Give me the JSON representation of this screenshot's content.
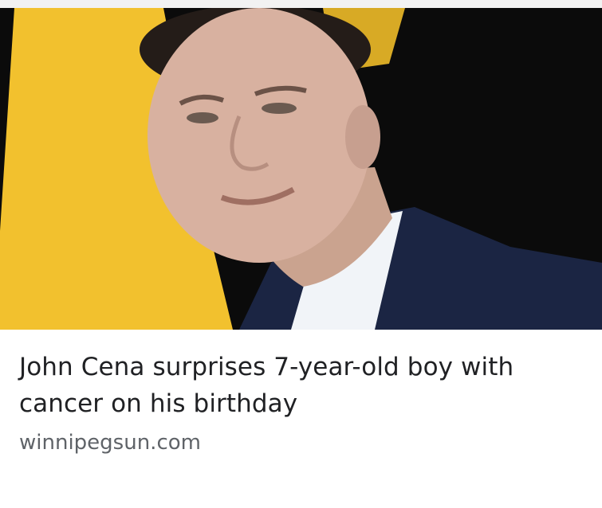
{
  "article": {
    "headline": "John Cena surprises 7-year-old boy with cancer on his birthday",
    "source": "winnipegsun.com"
  },
  "thumbnail": {
    "background_colors": [
      "#f2c12e",
      "#0b0b0b"
    ],
    "suit_color": "#1b2543"
  }
}
